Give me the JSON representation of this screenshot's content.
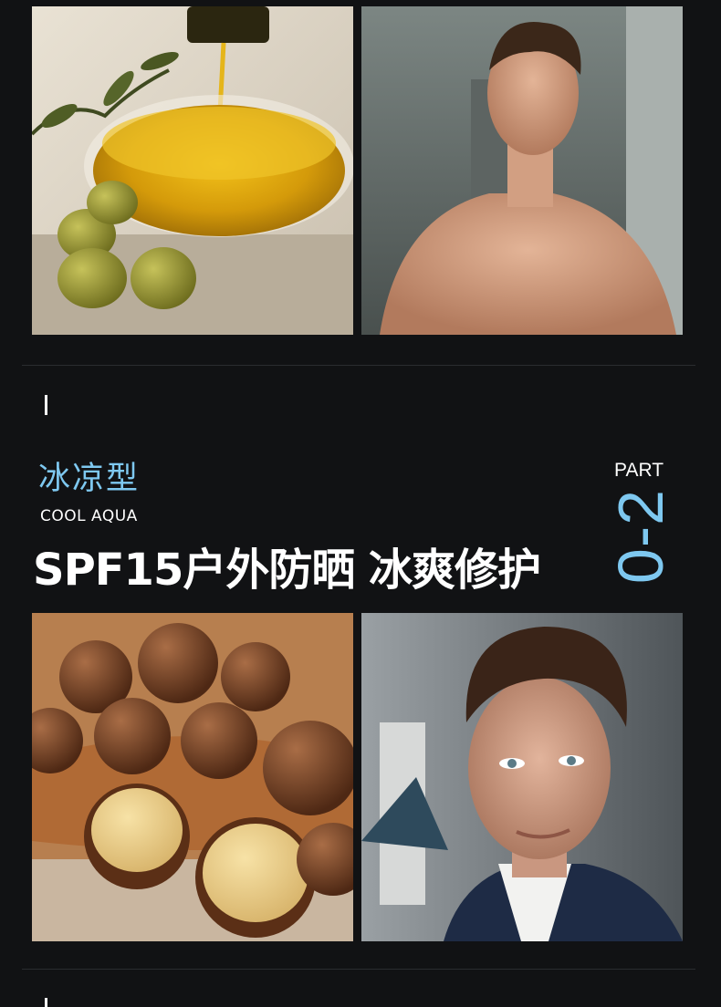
{
  "images": {
    "top_left": "olive-oil-photo",
    "top_right": "man-portrait-photo",
    "bottom_left": "macadamia-nuts-photo",
    "bottom_right": "man-face-photo"
  },
  "section": {
    "type_zh": "冰凉型",
    "type_en": "COOL AQUA",
    "headline": "SPF15户外防晒 冰爽修护",
    "part_label": "PART",
    "part_number": "0-2"
  },
  "colors": {
    "background": "#111214",
    "accent": "#7ec8f0",
    "text": "#ffffff"
  }
}
